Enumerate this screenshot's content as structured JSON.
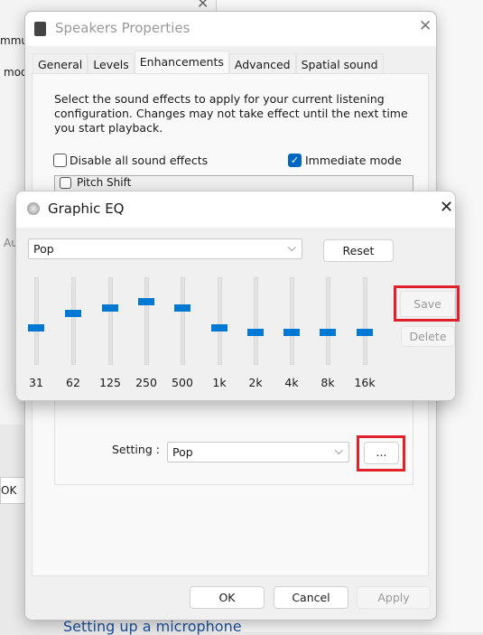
{
  "background": {
    "fragments": [
      "mmu",
      "mod",
      "Au",
      "OK"
    ],
    "link": "Setting up a microphone"
  },
  "speakers": {
    "title": "Speakers Properties",
    "tabs": [
      {
        "label": "General"
      },
      {
        "label": "Levels"
      },
      {
        "label": "Enhancements",
        "active": true
      },
      {
        "label": "Advanced"
      },
      {
        "label": "Spatial sound"
      }
    ],
    "description": "Select the sound effects to apply for your current listening configuration. Changes may not take effect until the next time you start playback.",
    "disable_all": {
      "label": "Disable all sound effects",
      "checked": false
    },
    "immediate": {
      "label": "Immediate mode",
      "checked": true
    },
    "list_item": "Pitch Shift",
    "setting_label": "Setting :",
    "setting_value": "Pop",
    "more_button": "...",
    "ok": "OK",
    "cancel": "Cancel",
    "apply": "Apply"
  },
  "eq": {
    "title": "Graphic EQ",
    "preset": "Pop",
    "reset": "Reset",
    "save": "Save",
    "delete": "Delete",
    "accent": "#0078d4",
    "highlight": "#e0202a",
    "bands": [
      {
        "label": "31",
        "level": 0.42
      },
      {
        "label": "62",
        "level": 0.59
      },
      {
        "label": "125",
        "level": 0.65
      },
      {
        "label": "250",
        "level": 0.72
      },
      {
        "label": "500",
        "level": 0.65
      },
      {
        "label": "1k",
        "level": 0.42
      },
      {
        "label": "2k",
        "level": 0.37
      },
      {
        "label": "4k",
        "level": 0.37
      },
      {
        "label": "8k",
        "level": 0.37
      },
      {
        "label": "16k",
        "level": 0.37
      }
    ]
  }
}
